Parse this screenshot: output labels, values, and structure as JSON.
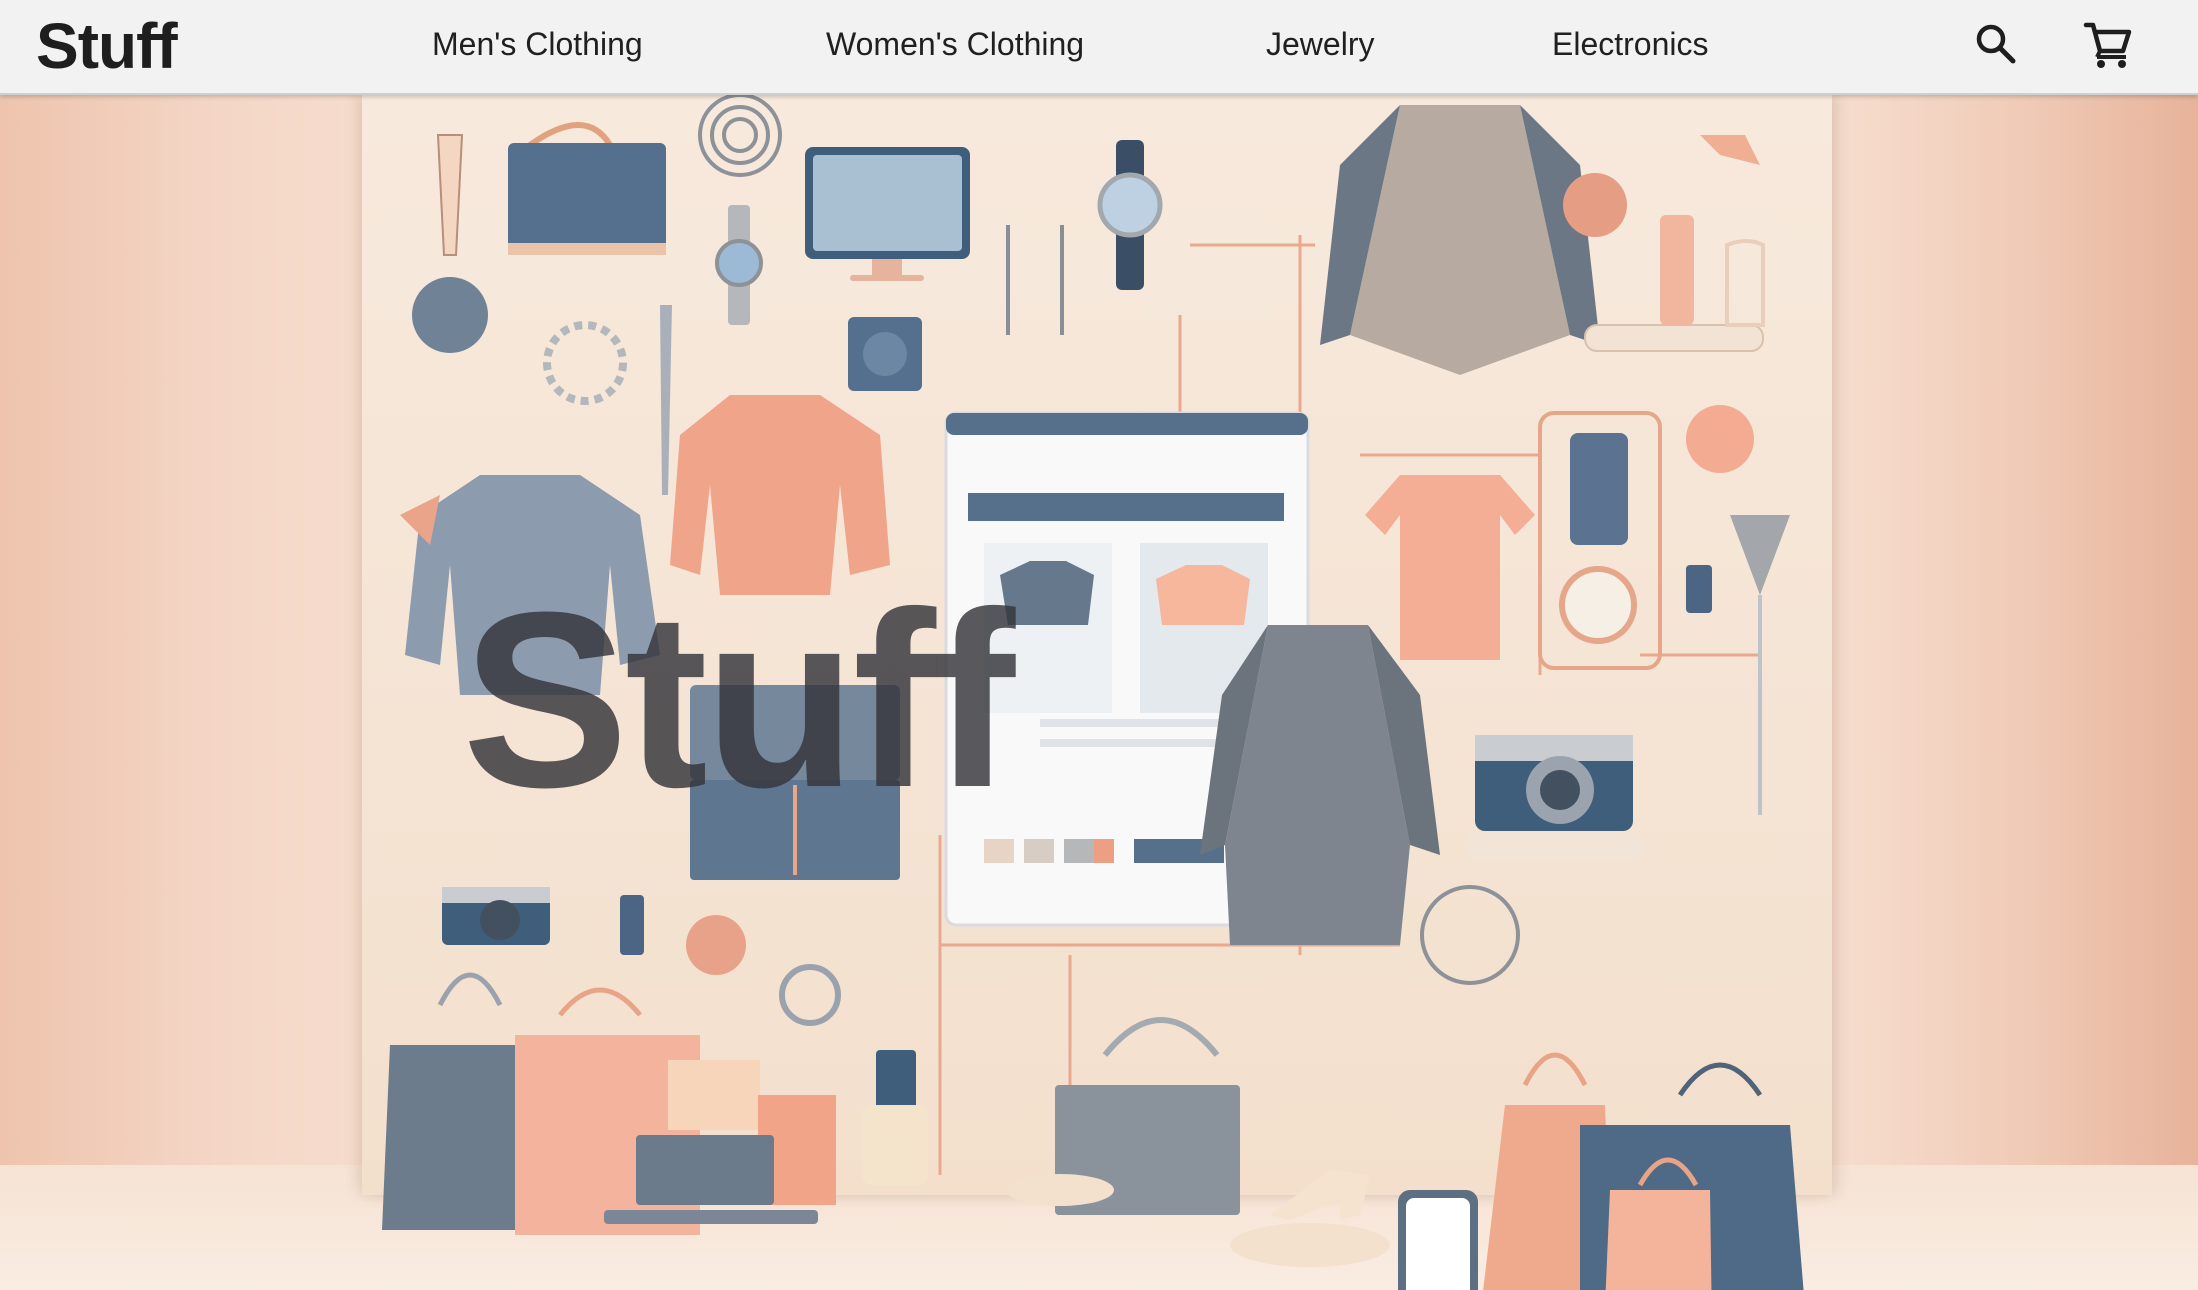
{
  "navbar": {
    "logo": "Stuff",
    "links": [
      {
        "label": "Men's Clothing"
      },
      {
        "label": "Women's Clothing"
      },
      {
        "label": "Jewelry"
      },
      {
        "label": "Electronics"
      }
    ],
    "search_icon": "search-icon",
    "cart_icon": "cart-icon"
  },
  "hero": {
    "title": "Stuff",
    "image_alt": "Collage of clothing, jewelry, bags and electronics",
    "colors": {
      "peach": "#f2a68a",
      "slate": "#5b6f86",
      "gray": "#8a9097",
      "cream": "#f6e6d6"
    }
  }
}
